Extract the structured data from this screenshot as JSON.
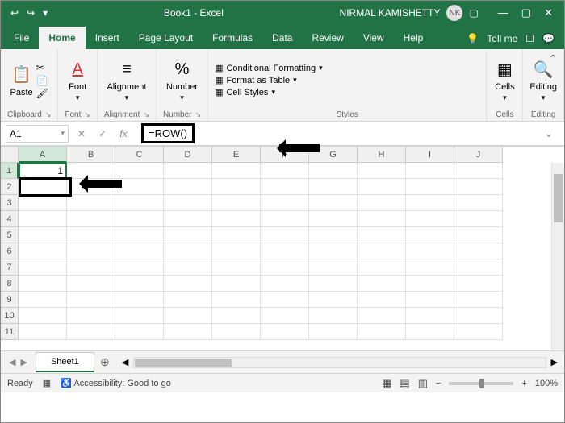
{
  "title_bar": {
    "undo_icon": "↩",
    "redo_icon": "↪",
    "doc_title": "Book1 - Excel",
    "user_name": "NIRMAL KAMISHETTY",
    "user_initials": "NK",
    "ribbon_display": "▢",
    "minimize": "—",
    "restore": "▢",
    "close": "✕"
  },
  "tabs": {
    "file": "File",
    "home": "Home",
    "insert": "Insert",
    "page_layout": "Page Layout",
    "formulas": "Formulas",
    "data": "Data",
    "review": "Review",
    "view": "View",
    "help": "Help",
    "tell_me": "Tell me",
    "share": "☐",
    "comments": "💬"
  },
  "ribbon": {
    "clipboard": {
      "paste": "Paste",
      "label": "Clipboard"
    },
    "font": {
      "btn": "Font",
      "label": "Font"
    },
    "alignment": {
      "btn": "Alignment",
      "label": "Alignment"
    },
    "number": {
      "btn": "Number",
      "label": "Number"
    },
    "styles": {
      "cond_fmt": "Conditional Formatting",
      "fmt_table": "Format as Table",
      "cell_styles": "Cell Styles",
      "label": "Styles"
    },
    "cells": {
      "btn": "Cells",
      "label": "Cells"
    },
    "editing": {
      "btn": "Editing",
      "label": "Editing"
    }
  },
  "formula_bar": {
    "name_box": "A1",
    "formula": "=ROW()",
    "fx": "fx"
  },
  "grid": {
    "columns": [
      "A",
      "B",
      "C",
      "D",
      "E",
      "F",
      "G",
      "H",
      "I",
      "J"
    ],
    "rows": [
      "1",
      "2",
      "3",
      "4",
      "5",
      "6",
      "7",
      "8",
      "9",
      "10",
      "11"
    ],
    "active_cell_value": "1"
  },
  "sheet_bar": {
    "tab": "Sheet1",
    "add": "⊕",
    "nav_prev": "◀",
    "nav_next": "▶"
  },
  "status_bar": {
    "ready": "Ready",
    "macro": "▦",
    "accessibility": "Accessibility: Good to go",
    "zoom": "100%",
    "minus": "−",
    "plus": "+"
  }
}
